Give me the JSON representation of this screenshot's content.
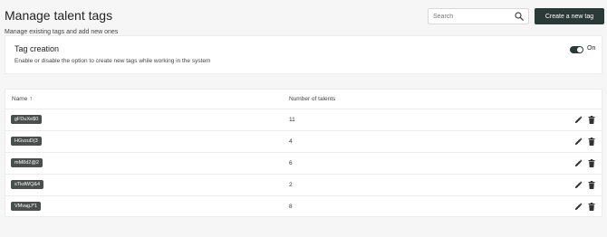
{
  "header": {
    "title": "Manage talent tags",
    "subtitle": "Manage existing tags and add new ones",
    "search_placeholder": "Search",
    "create_button_label": "Create a new tag"
  },
  "tag_creation": {
    "title": "Tag creation",
    "description": "Enable or disable the option to create new tags while working in the system",
    "toggle_state_label": "On",
    "toggle_on": true
  },
  "table": {
    "columns": {
      "name": "Name",
      "count": "Number of talents"
    },
    "sort_indicator": "↑",
    "rows": [
      {
        "tag": "gFDuXe$0",
        "count": "11"
      },
      {
        "tag": "HGvzuD(3",
        "count": "4"
      },
      {
        "tag": "mM8d2@2",
        "count": "6"
      },
      {
        "tag": "sTkdWQ&4",
        "count": "2"
      },
      {
        "tag": "VMvagJ*1",
        "count": "8"
      }
    ]
  },
  "colors": {
    "accent": "#2b3a36",
    "chip": "#4a4f4e",
    "background": "#f6f6f6"
  }
}
